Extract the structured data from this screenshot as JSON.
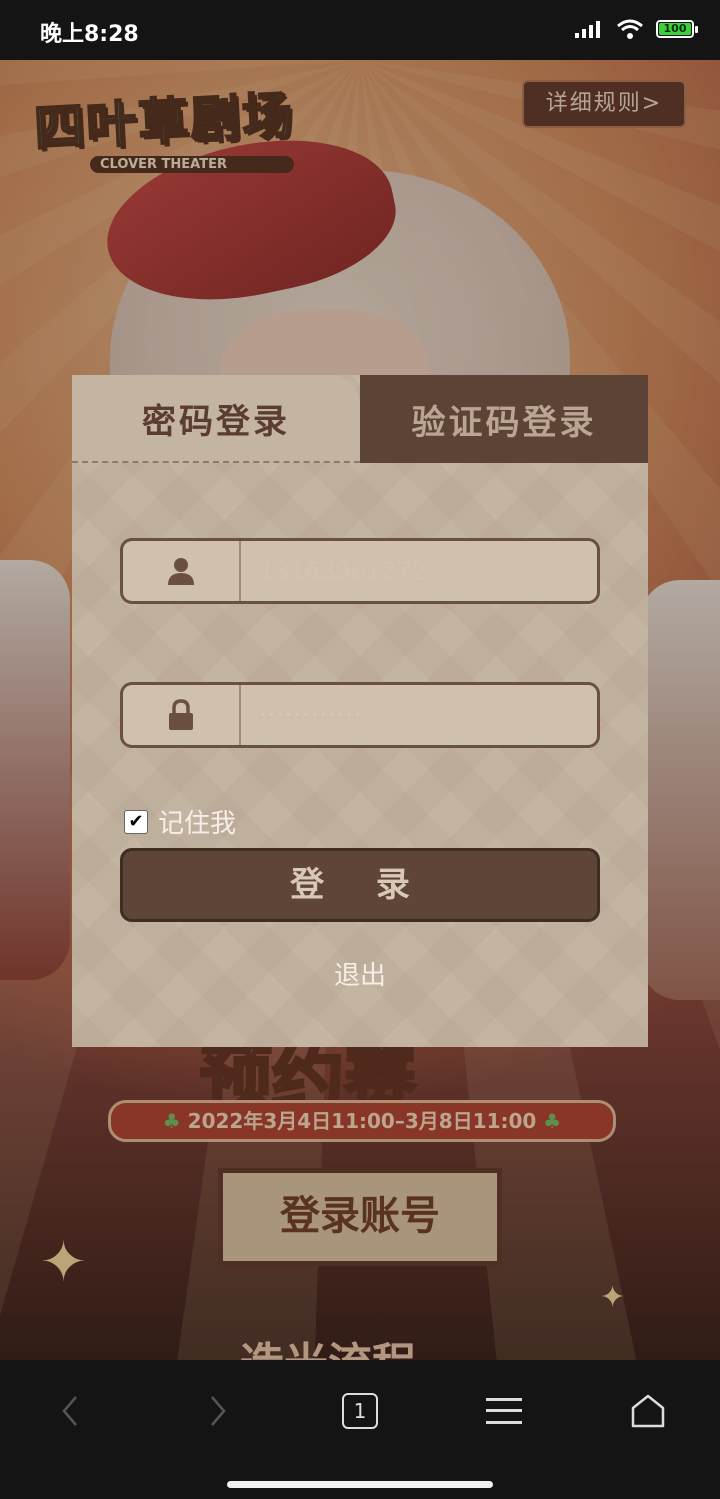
{
  "status_bar": {
    "time": "晚上8:28",
    "battery": "100"
  },
  "background": {
    "logo_title": "四叶草剧场",
    "logo_subtitle": "CLOVER THEATER",
    "rules_button": "详细规则>",
    "banner_title": "预约赛",
    "date_range": "2022年3月4日11:00–3月8日11:00",
    "login_account_button": "登录账号",
    "flow_title": "造光流程"
  },
  "login_dialog": {
    "tabs": [
      {
        "label": "密码登录",
        "active": true
      },
      {
        "label": "验证码登录",
        "active": false
      }
    ],
    "username": {
      "value": "13163961272",
      "icon": "user-icon"
    },
    "password": {
      "masked": "············",
      "icon": "lock-icon"
    },
    "remember": {
      "label": "记住我",
      "checked": true
    },
    "login_button": "登 录",
    "logout_link": "退出"
  },
  "nav_bar": {
    "tab_count": "1",
    "icons": [
      "back-icon",
      "forward-icon",
      "tabs-icon",
      "menu-icon",
      "home-icon"
    ]
  },
  "colors": {
    "dialog_bg": "#c4b5a2",
    "tab_inactive_bg": "#5c4336",
    "button_bg": "#5e4537",
    "accent_red": "#b33c2e"
  }
}
